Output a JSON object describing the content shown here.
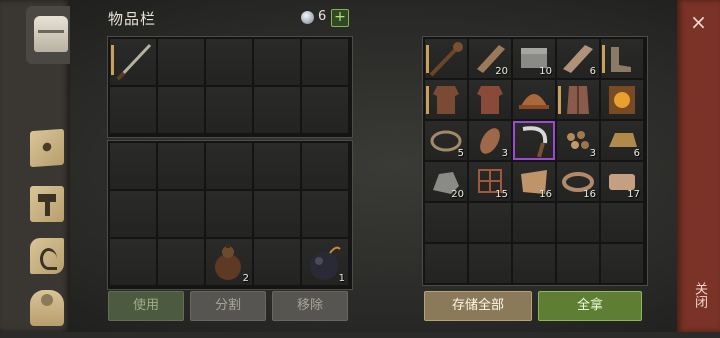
{
  "header": {
    "title": "物品栏",
    "gem_count": "6",
    "plus": "+"
  },
  "sidebar": {
    "tabs": [
      {
        "name": "chest-icon",
        "active": true
      },
      {
        "name": "map-icon",
        "active": false
      },
      {
        "name": "hammer-icon",
        "active": false
      },
      {
        "name": "scroll-icon",
        "active": false
      },
      {
        "name": "character-icon",
        "active": false
      }
    ]
  },
  "inventory": {
    "slot_weapon": {
      "item": "sword-icon",
      "qty": ""
    },
    "slot_gourd": {
      "item": "gourd-icon",
      "qty": "2"
    },
    "slot_bomb": {
      "item": "bomb-icon",
      "qty": "1"
    }
  },
  "storage": {
    "row1": [
      {
        "item": "spiked-club-icon",
        "qty": ""
      },
      {
        "item": "wood-plank-icon",
        "qty": "20"
      },
      {
        "item": "stone-block-icon",
        "qty": "10"
      },
      {
        "item": "wood-log-icon",
        "qty": "6"
      },
      {
        "item": "boots-icon",
        "qty": ""
      }
    ],
    "row2": [
      {
        "item": "leather-armor-icon",
        "qty": ""
      },
      {
        "item": "leather-shirt-icon",
        "qty": ""
      },
      {
        "item": "helmet-icon",
        "qty": ""
      },
      {
        "item": "vest-icon",
        "qty": ""
      },
      {
        "item": "spellbook-icon",
        "qty": ""
      }
    ],
    "row3": [
      {
        "item": "bear-trap-icon",
        "qty": "5"
      },
      {
        "item": "meat-icon",
        "qty": "3"
      },
      {
        "item": "sickle-icon",
        "qty": ""
      },
      {
        "item": "seeds-icon",
        "qty": "3"
      },
      {
        "item": "ingot-icon",
        "qty": "6"
      }
    ],
    "row4": [
      {
        "item": "ore-icon",
        "qty": "20"
      },
      {
        "item": "net-icon",
        "qty": "15"
      },
      {
        "item": "hide-icon",
        "qty": "16"
      },
      {
        "item": "rope-icon",
        "qty": "16"
      },
      {
        "item": "cloth-icon",
        "qty": "17"
      }
    ]
  },
  "buttons": {
    "use": "使用",
    "split": "分割",
    "remove": "移除",
    "store_all": "存储全部",
    "take_all": "全拿"
  },
  "close": {
    "icon": "×",
    "label": "关闭"
  },
  "colors": {
    "close_strip": "#7a3326",
    "take_button": "#5e7e34",
    "store_button": "#8a7a5a",
    "selected_border": "#9a4bd0"
  }
}
